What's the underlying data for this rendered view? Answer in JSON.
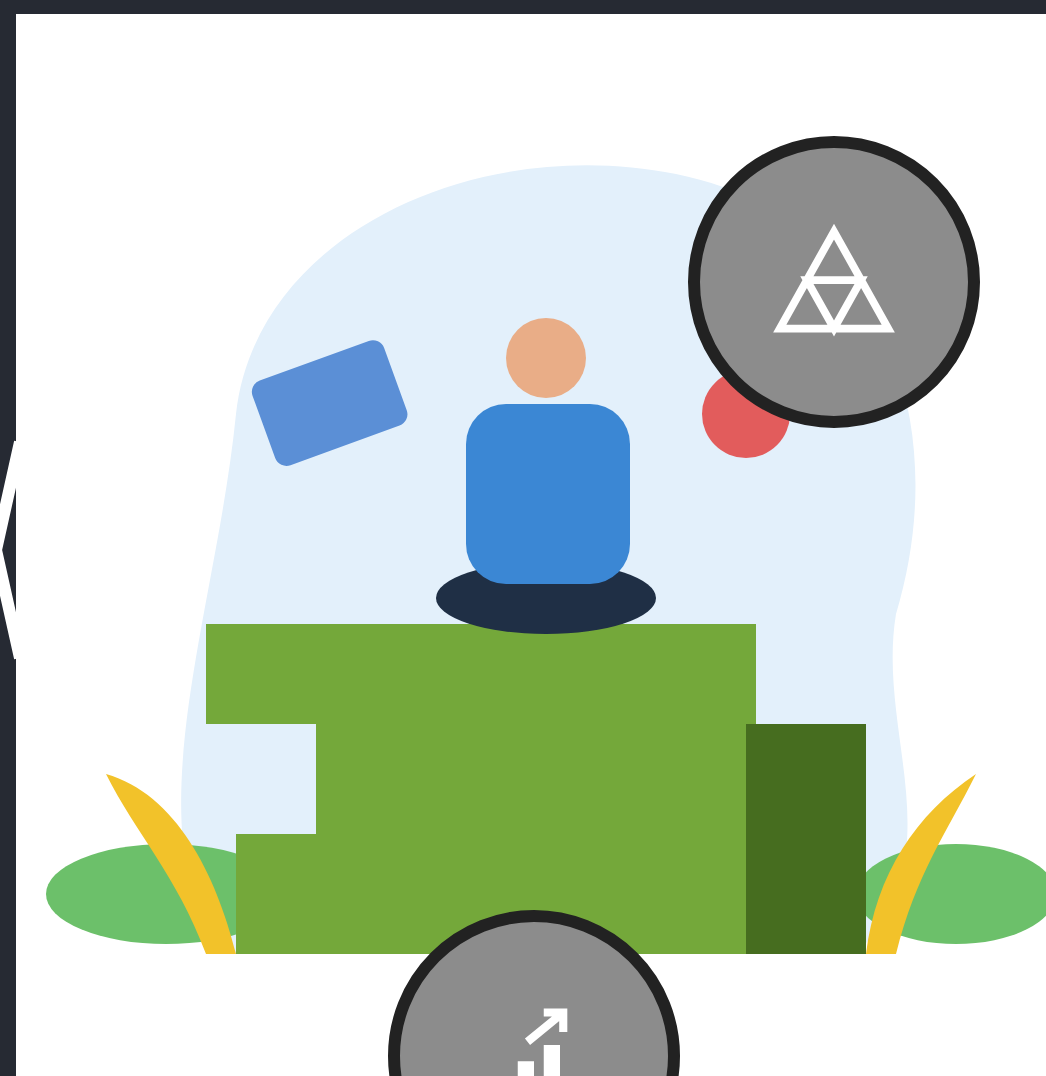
{
  "nav": {
    "kind": "previous"
  },
  "buttons": [
    {
      "kind": "triangles"
    },
    {
      "kind": "growth"
    }
  ]
}
